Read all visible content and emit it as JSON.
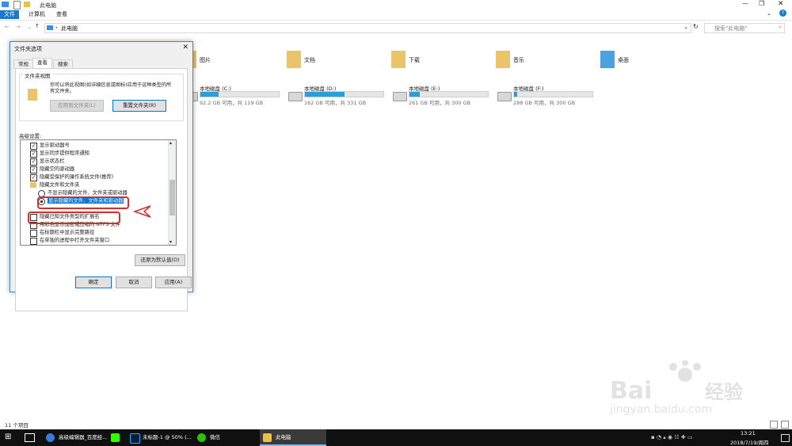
{
  "window": {
    "title": "此电脑"
  },
  "ribbon": {
    "tabs": [
      "文件",
      "计算机",
      "查看"
    ]
  },
  "address": {
    "path": "此电脑",
    "search_placeholder": "搜索\"此电脑\""
  },
  "folders": [
    {
      "label": "图片"
    },
    {
      "label": "文档"
    },
    {
      "label": "下载"
    },
    {
      "label": "音乐"
    },
    {
      "label": "桌面"
    }
  ],
  "drives": [
    {
      "name": "本地磁盘 (C:)",
      "size": "92.2 GB 可用，共 119 GB",
      "used_fraction": 0.23
    },
    {
      "name": "本地磁盘 (D:)",
      "size": "162 GB 可用，共 331 GB",
      "used_fraction": 0.51
    },
    {
      "name": "本地磁盘 (E:)",
      "size": "261 GB 可用，共 300 GB",
      "used_fraction": 0.13
    },
    {
      "name": "本地磁盘 (F:)",
      "size": "288 GB 可用，共 300 GB",
      "used_fraction": 0.04
    }
  ],
  "status": {
    "items": "11 个项目"
  },
  "dialog": {
    "title": "文件夹选项",
    "tabs": [
      "常规",
      "查看",
      "搜索"
    ],
    "folder_view_heading": "文件夹视图",
    "folder_view_desc_1": "你可以将此视图(如详细信息或图标)应用于这种类型的所",
    "folder_view_desc_2": "有文件夹。",
    "apply_to_folders": "应用到文件夹(L)",
    "reset_folders": "重置文件夹(R)",
    "advanced_heading": "高级设置:",
    "items": [
      {
        "type": "check",
        "checked": true,
        "label": "显示驱动器号"
      },
      {
        "type": "check",
        "checked": true,
        "label": "显示同步提供程序通知"
      },
      {
        "type": "check",
        "checked": true,
        "label": "显示状态栏"
      },
      {
        "type": "check",
        "checked": true,
        "label": "隐藏空的驱动器"
      },
      {
        "type": "check",
        "checked": true,
        "label": "隐藏受保护的操作系统文件(推荐)"
      },
      {
        "type": "folder",
        "label": "隐藏文件和文件夹"
      },
      {
        "type": "radio",
        "checked": false,
        "label": "不显示隐藏的文件、文件夹或驱动器"
      },
      {
        "type": "radio",
        "checked": true,
        "label": "显示隐藏的文件、文件夹和驱动器"
      },
      {
        "type": "check",
        "checked": false,
        "label": "隐藏已知文件类型的扩展名"
      },
      {
        "type": "check",
        "checked": false,
        "label": "用彩色显示加密或压缩的 NTFS 文件"
      },
      {
        "type": "check",
        "checked": false,
        "label": "在标题栏中显示完整路径"
      },
      {
        "type": "check",
        "checked": false,
        "label": "在单独的进程中打开文件夹窗口"
      }
    ],
    "restore_defaults": "还原为默认值(D)",
    "ok": "确定",
    "cancel": "取消",
    "apply": "应用(A)"
  },
  "taskbar": {
    "apps": [
      "高级编辑器_百度经...",
      "未标题-1 @ 50% (...",
      "微信",
      "此电脑"
    ],
    "time": "13:21",
    "date": "2018/7/19/周四"
  },
  "colors": {
    "accent": "#1979ca",
    "drive_fill": "#26a0da",
    "highlight": "#d03030"
  }
}
